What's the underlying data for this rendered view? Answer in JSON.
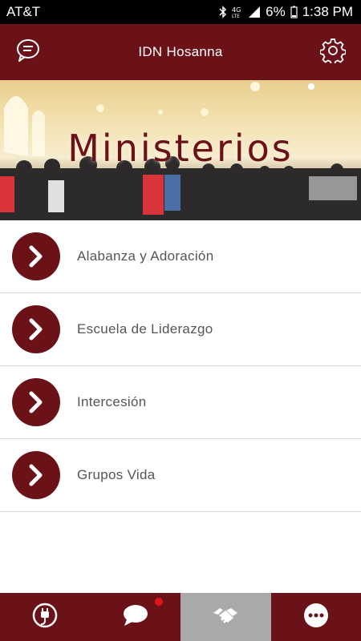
{
  "status_bar": {
    "carrier": "AT&T",
    "battery": "6%",
    "time": "1:38 PM",
    "icons": [
      "bluetooth-icon",
      "lte-icon",
      "signal-icon",
      "battery-icon"
    ]
  },
  "header": {
    "title": "IDN Hosanna",
    "left_icon": "chat-icon",
    "right_icon": "gear-icon"
  },
  "banner": {
    "title": "Ministerios"
  },
  "menu": {
    "items": [
      {
        "label": "Alabanza y Adoración"
      },
      {
        "label": "Escuela de Liderazgo"
      },
      {
        "label": "Intercesión"
      },
      {
        "label": "Grupos Vida"
      }
    ]
  },
  "tabs": [
    {
      "icon": "plug-icon",
      "active": false
    },
    {
      "icon": "chat-bubble-icon",
      "active": false,
      "notification": true
    },
    {
      "icon": "handshake-icon",
      "active": true
    },
    {
      "icon": "more-icon",
      "active": false
    }
  ],
  "colors": {
    "brand": "#6b1218",
    "active_tab": "#a9a9a9",
    "notification": "#e0151c"
  }
}
